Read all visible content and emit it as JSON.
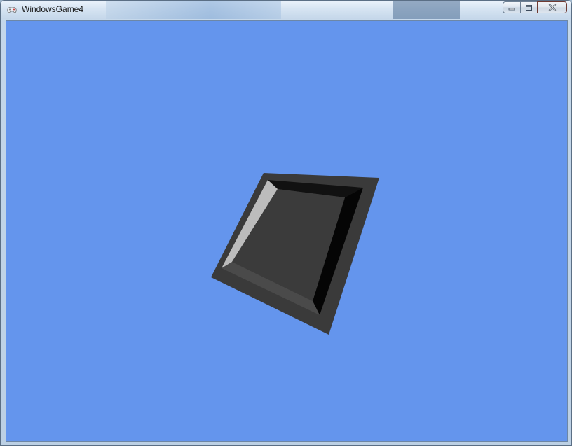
{
  "window": {
    "title": "WindowsGame4",
    "icon": "xna-controller-icon",
    "buttons": {
      "minimize": "minimize-icon",
      "maximize": "maximize-icon",
      "close": "close-icon"
    }
  },
  "game": {
    "background_color": "#6495ed",
    "object": "rotated-square-tray",
    "colors": {
      "rim": "#3a3a3a",
      "floor": "#3b3b3b",
      "bevel_light": "#bcbcbc",
      "bevel_dark": "#050505",
      "bevel_mid": "#4a4a4a"
    }
  }
}
